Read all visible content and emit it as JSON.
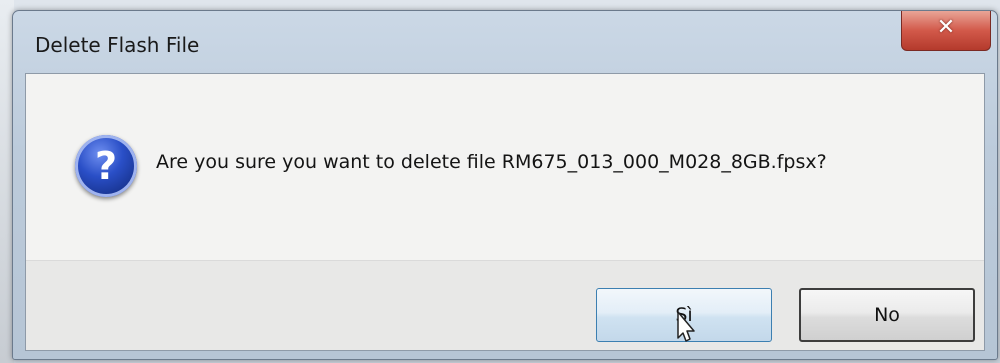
{
  "dialog": {
    "title": "Delete Flash File",
    "message": "Are you sure you want to delete file RM675_013_000_M028_8GB.fpsx?",
    "icon": "question-icon",
    "close_icon": "close-icon",
    "close_glyph": "✕",
    "question_glyph": "?"
  },
  "buttons": {
    "yes_label": "Sì",
    "no_label": "No"
  },
  "colors": {
    "close_button": "#d2594a",
    "question_icon": "#2a4fc7"
  }
}
